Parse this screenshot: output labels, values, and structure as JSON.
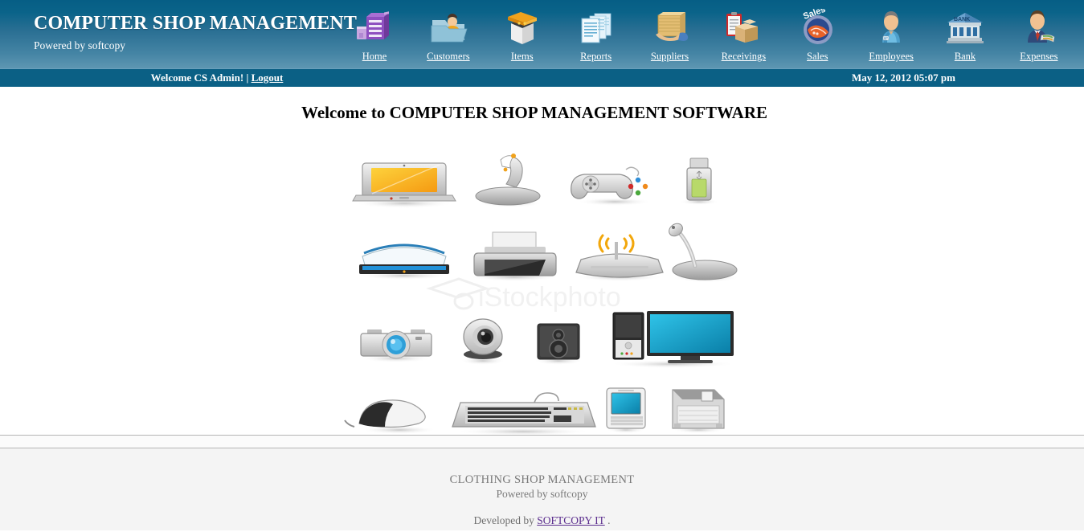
{
  "header": {
    "title": "COMPUTER SHOP MANAGEMENT",
    "subtitle": "Powered by softcopy",
    "bg_top_color": "#065e85",
    "bg_bottom_color": "#5e96b2"
  },
  "nav": {
    "items": [
      {
        "label": "Home",
        "icon": "building-blocks-icon"
      },
      {
        "label": "Customers",
        "icon": "user-folder-icon"
      },
      {
        "label": "Items",
        "icon": "open-box-icon"
      },
      {
        "label": "Reports",
        "icon": "documents-icon"
      },
      {
        "label": "Suppliers",
        "icon": "hand-holding-box-icon"
      },
      {
        "label": "Receivings",
        "icon": "clipboard-package-icon"
      },
      {
        "label": "Sales",
        "icon": "handshake-sales-icon"
      },
      {
        "label": "Employees",
        "icon": "employee-badge-icon"
      },
      {
        "label": "Bank",
        "icon": "bank-building-icon"
      },
      {
        "label": "Expenses",
        "icon": "businessman-money-icon"
      }
    ]
  },
  "statusbar": {
    "welcome_text": "Welcome CS Admin!",
    "separator": "|",
    "logout_label": "Logout",
    "datetime": "May 12, 2012 05:07 pm",
    "bg_color": "#0b6085"
  },
  "main": {
    "heading": "Welcome to COMPUTER SHOP MANAGEMENT SOFTWARE",
    "hero_image": {
      "name": "computer-hardware-icons-collage",
      "watermark": "iStockphoto",
      "items": [
        "laptop",
        "joystick",
        "gamepad",
        "usb-flash-drive",
        "scanner",
        "printer",
        "wireless-router",
        "desk-microphone",
        "camera",
        "webcam",
        "speaker",
        "desktop-computer-and-monitor",
        "mouse",
        "keyboard",
        "pda-phone",
        "floppy-disk"
      ]
    }
  },
  "footer": {
    "line1": "CLOTHING SHOP MANAGEMENT",
    "line2": "Powered by softcopy",
    "developed_prefix": "Developed by",
    "developer_link": "SOFTCOPY IT",
    "developed_suffix": ".",
    "bg_color": "#f4f4f4"
  }
}
